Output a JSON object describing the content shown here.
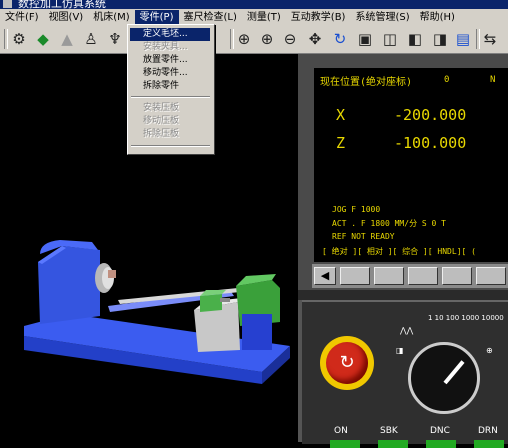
{
  "window": {
    "title": "数控加工仿真系统"
  },
  "menubar": {
    "items": [
      {
        "label": "文件(F)"
      },
      {
        "label": "视图(V)"
      },
      {
        "label": "机床(M)"
      },
      {
        "label": "零件(P)",
        "active": true
      },
      {
        "label": "塞尺检查(L)"
      },
      {
        "label": "测量(T)"
      },
      {
        "label": "互动教学(B)"
      },
      {
        "label": "系统管理(S)"
      },
      {
        "label": "帮助(H)"
      }
    ]
  },
  "dropdown": {
    "items": [
      {
        "label": "定义毛坯...",
        "state": "selected"
      },
      {
        "label": "安装夹具...",
        "state": "disabled"
      },
      {
        "label": "放置零件...",
        "state": "enabled"
      },
      {
        "label": "移动零件...",
        "state": "enabled"
      },
      {
        "label": "拆除零件",
        "state": "enabled"
      },
      {
        "label": "安装压板",
        "state": "disabled"
      },
      {
        "label": "移动压板",
        "state": "disabled"
      },
      {
        "label": "拆除压板",
        "state": "disabled"
      }
    ]
  },
  "toolbar": {
    "icons": [
      "machine-select-icon",
      "blank-define-icon",
      "fixture-icon",
      "place-part-icon",
      "tool-select-icon",
      "zoom-region-icon",
      "zoom-in-icon",
      "zoom-out-icon",
      "pan-icon",
      "rotate-icon",
      "view-front-icon",
      "view-top-icon",
      "view-left-icon",
      "view-right-icon",
      "control-panel-icon",
      "switch-panel-icon"
    ]
  },
  "cnc": {
    "position_title": "现在位置(绝对座标)",
    "o_label": "0",
    "n_label": "N",
    "axes": [
      {
        "axis": "X",
        "value": "-200.000"
      },
      {
        "axis": "Z",
        "value": "-100.000"
      }
    ],
    "jog_line": "JOG  F  1000",
    "act_line": "ACT . F 1800  MM/分     S  0   T",
    "ready_line": "REF NOT READY",
    "softkeys": "[ 绝对 ][ 相对 ][ 综合 ][ HNDL][ (",
    "rapid_scale": "1 10 100 1000 10000",
    "mode_labels": [
      "ON",
      "SBK",
      "DNC",
      "DRN"
    ]
  },
  "colors": {
    "screen_text": "#e8d800",
    "machine_blue": "#3555e0",
    "estop_red": "#d02a1a",
    "menu_highlight": "#0a246a"
  }
}
